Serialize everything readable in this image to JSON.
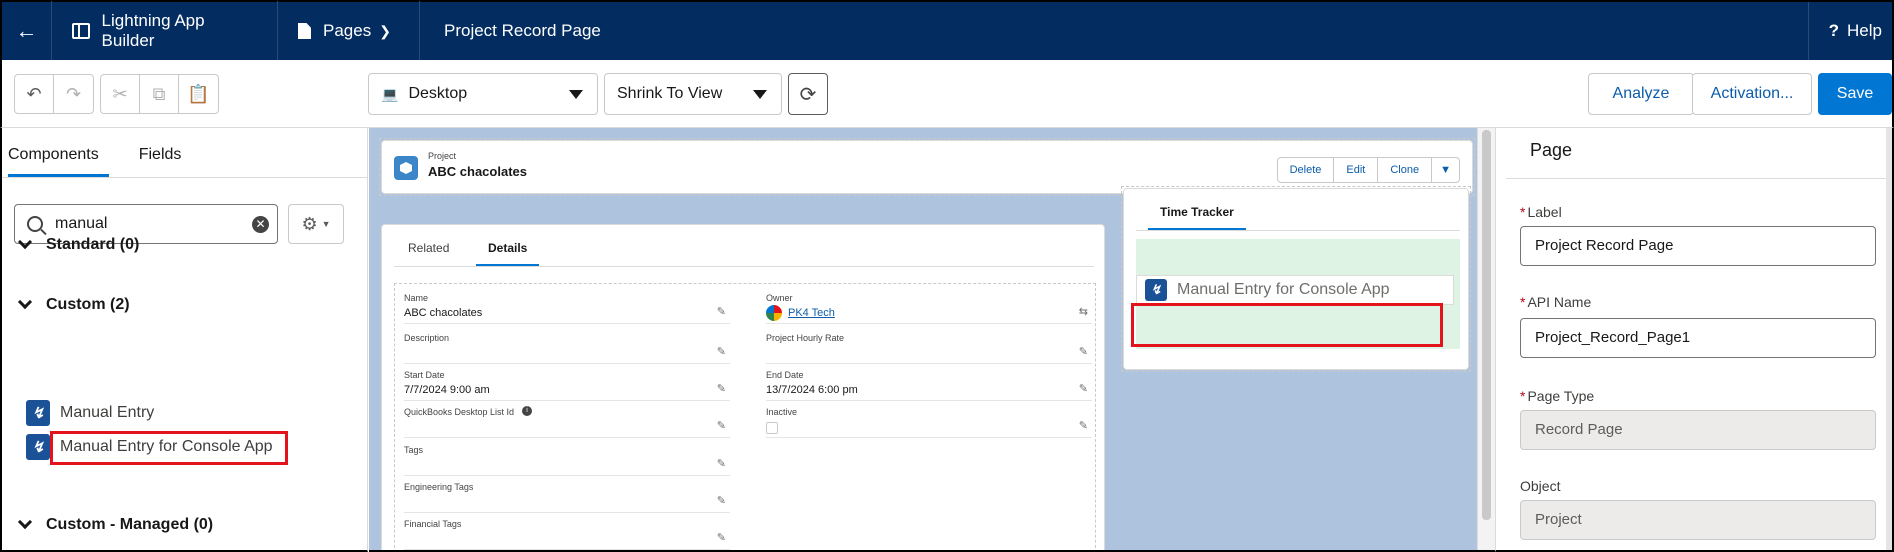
{
  "header": {
    "app_name": "Lightning App Builder",
    "pages_label": "Pages",
    "page_title": "Project Record Page",
    "help_label": "Help"
  },
  "toolbar": {
    "device_select": "Desktop",
    "view_select": "Shrink To View",
    "analyze_label": "Analyze",
    "activation_label": "Activation...",
    "save_label": "Save"
  },
  "left_panel": {
    "tabs": [
      "Components",
      "Fields"
    ],
    "search_value": "manual",
    "sections": {
      "standard": "Standard (0)",
      "custom": "Custom (2)",
      "custom_managed": "Custom - Managed (0)"
    },
    "components": [
      "Manual Entry",
      "Manual Entry for Console App"
    ]
  },
  "canvas": {
    "record_header": {
      "object": "Project",
      "name": "ABC chacolates",
      "actions": [
        "Delete",
        "Edit",
        "Clone"
      ]
    },
    "tabs": [
      "Related",
      "Details"
    ],
    "fields_left": [
      {
        "label": "Name",
        "value": "ABC chacolates"
      },
      {
        "label": "Description",
        "value": ""
      },
      {
        "label": "Start Date",
        "value": "7/7/2024 9:00 am"
      },
      {
        "label": "QuickBooks Desktop List Id",
        "value": ""
      },
      {
        "label": "Tags",
        "value": ""
      },
      {
        "label": "Engineering Tags",
        "value": ""
      },
      {
        "label": "Financial Tags",
        "value": ""
      }
    ],
    "fields_right": [
      {
        "label": "Owner",
        "value": "PK4 Tech"
      },
      {
        "label": "Project Hourly Rate",
        "value": ""
      },
      {
        "label": "End Date",
        "value": "13/7/2024 6:00 pm"
      },
      {
        "label": "Inactive",
        "value": ""
      }
    ],
    "sidebar_tab": "Time Tracker",
    "dropped_component": "Manual Entry for Console App"
  },
  "right_panel": {
    "title": "Page",
    "label_label": "Label",
    "label_value": "Project Record Page",
    "api_name_label": "API Name",
    "api_name_value": "Project_Record_Page1",
    "page_type_label": "Page Type",
    "page_type_value": "Record Page",
    "object_label": "Object",
    "object_value": "Project"
  },
  "colors": {
    "header_bg": "#032d60",
    "brand_blue": "#0176d3",
    "highlight_red": "#e4121b",
    "drop_zone_green": "#dff3e4"
  }
}
